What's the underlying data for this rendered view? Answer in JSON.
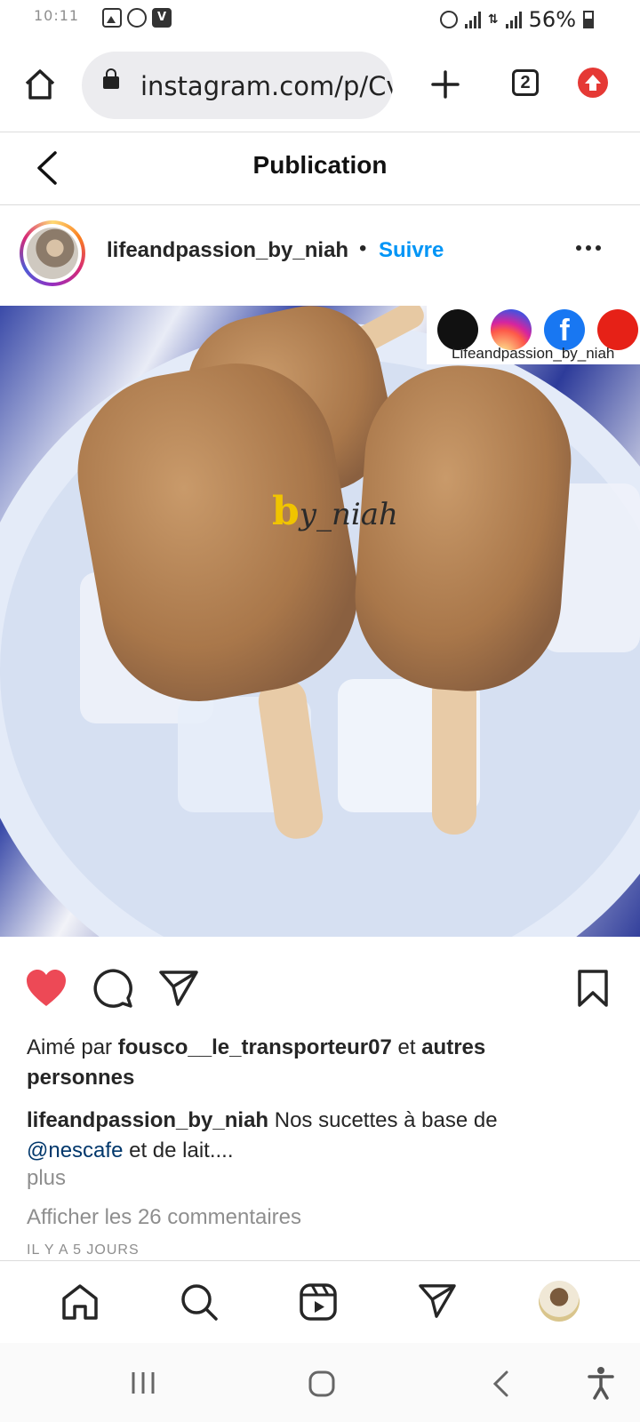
{
  "status_bar": {
    "time": "10:11",
    "battery": "56%",
    "notification_icons": [
      "gallery-icon",
      "whatsapp-icon",
      "v-icon"
    ],
    "system_icons": [
      "alarm-icon",
      "signal-icon",
      "data-icon",
      "signal-icon"
    ]
  },
  "browser": {
    "url": "instagram.com/p/Cv",
    "tab_count": "2"
  },
  "header": {
    "title": "Publication"
  },
  "post": {
    "username": "lifeandpassion_by_niah",
    "separator": "•",
    "follow_label": "Suivre",
    "image": {
      "watermark_text": "Lifeandpassion_by_niah",
      "watermark_icons": [
        "tiktok-icon",
        "instagram-icon",
        "facebook-icon",
        "youtube-icon"
      ],
      "overlay_b": "b",
      "overlay_text": "y_niah"
    },
    "liked": true,
    "likes": {
      "prefix": "Aimé par",
      "user": "fousco__le_transporteur07",
      "middle": "et",
      "suffix": "autres personnes"
    },
    "caption": {
      "user": "lifeandpassion_by_niah",
      "text_before": "Nos sucettes à base de",
      "mention": "@nescafe",
      "text_after": "et de lait...."
    },
    "more_label": "plus",
    "comments_label": "Afficher les 26 commentaires",
    "timestamp": "IL Y A 5 JOURS"
  },
  "colors": {
    "accent_blue": "#0095f6",
    "like_red": "#ed4956",
    "mention": "#00376b",
    "muted": "#8e8e8e"
  }
}
